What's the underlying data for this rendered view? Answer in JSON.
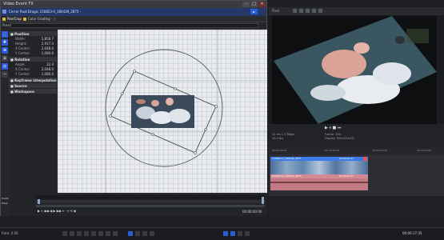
{
  "window": {
    "title": "Video Event FX",
    "close": "×",
    "max": "□",
    "min": "–"
  },
  "path": {
    "text": "Cerrar Raúl Draga: 150823-0_180439_2875 - ",
    "button": "►"
  },
  "plugins": {
    "left": "Pan/Crop",
    "right": "Color Grading · ⓘ"
  },
  "preset": {
    "label": "Preset",
    "value": ""
  },
  "props": {
    "position_header": "■ Position",
    "position_rows": [
      {
        "label": "Width:",
        "value": "5,858.7"
      },
      {
        "label": "Height:",
        "value": "2,917.4"
      },
      {
        "label": "X Center:",
        "value": "2,048.0"
      },
      {
        "label": "Y Center:",
        "value": "1,080.0"
      }
    ],
    "rotation_header": "■ Rotation",
    "rotation_rows": [
      {
        "label": "Angle:",
        "value": "22.4"
      },
      {
        "label": "X Center:",
        "value": "2,048.0"
      },
      {
        "label": "Y Center:",
        "value": "1,080.0"
      }
    ],
    "keyframe_header": "■ Keyframe interpolation",
    "source_header": "■ Source",
    "workspace_header": "■ Workspace"
  },
  "timeline": {
    "label_position": "Position",
    "label_mask": "Mask",
    "timecode": "00:00:00:00"
  },
  "preview": {
    "toolbar_label": "Pixel",
    "info_left": "12 ms  1.5 Mbps",
    "info_left2": "30.0 fps",
    "info_mid": "Frame:  150",
    "info_mid2": "Display: 555x324x32",
    "time_main": "00:00:05:00",
    "time_ruler_a": "00:00:10:00",
    "time_ruler_b": "00:00:15:00",
    "time_ruler_c": "00:00:20:00"
  },
  "tracks": {
    "clip_video_label": "150823-0_180439_2875",
    "clip_audio_label": "150823-0_180439_2875",
    "clip_video_time": "00:00:44:17",
    "clip_audio_time": "00:00:44:17"
  },
  "bottom": {
    "rate": "Rate: 0.00",
    "time": "00:00:17:35",
    "time2": "00:00:17:35"
  },
  "colors": {
    "accent": "#2a5bd7",
    "audio_clip": "#c27b85",
    "video_clip": "#2b6bdc"
  }
}
